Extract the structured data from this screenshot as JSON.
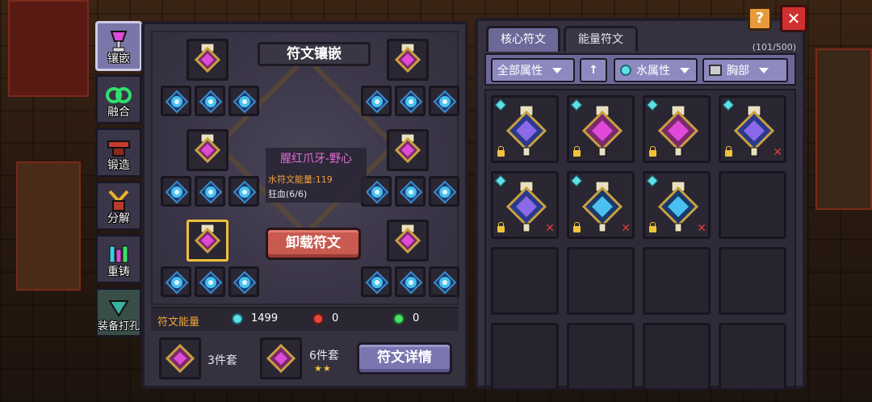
{
  "side_tabs": [
    {
      "label": "镶嵌",
      "icon": "goblet-icon",
      "active": true
    },
    {
      "label": "融合",
      "icon": "fuse-icon",
      "active": false
    },
    {
      "label": "锻造",
      "icon": "anvil-icon",
      "active": false
    },
    {
      "label": "分解",
      "icon": "decompose-icon",
      "active": false
    },
    {
      "label": "重铸",
      "icon": "recast-icon",
      "active": false
    },
    {
      "label": "装备打孔",
      "icon": "punch-icon",
      "active": false
    }
  ],
  "inlay": {
    "title": "符文镶嵌",
    "selected_rune": {
      "name": "腥红爪牙-野心",
      "energy": "水符文能量:119",
      "buff": "狂血(6/6)"
    },
    "unload_label": "卸载符文"
  },
  "energy": {
    "label": "符文能量",
    "water": "1499",
    "fire": "0",
    "nature": "0"
  },
  "sets": [
    {
      "label": "3件套"
    },
    {
      "label": "6件套",
      "stars": "★★"
    }
  ],
  "detail_label": "符文详情",
  "inventory": {
    "tabs": [
      "核心符文",
      "能量符文"
    ],
    "active_tab": 0,
    "count": "(101/500)",
    "filters": {
      "all": "全部属性",
      "sort": "↑",
      "element": "水属性",
      "slot": "胸部"
    },
    "items": [
      {
        "type": "blue-purple",
        "locked": true,
        "removable": false
      },
      {
        "type": "purple",
        "locked": true,
        "removable": false
      },
      {
        "type": "purple",
        "locked": true,
        "removable": false
      },
      {
        "type": "blue-purple",
        "locked": true,
        "removable": true
      },
      {
        "type": "blue-purple",
        "locked": true,
        "removable": true
      },
      {
        "type": "blue",
        "locked": true,
        "removable": true
      },
      {
        "type": "blue",
        "locked": true,
        "removable": true
      }
    ]
  },
  "buttons": {
    "help": "?",
    "close": "✕"
  },
  "colors": {
    "accent": "#6c6898",
    "danger": "#c85a50",
    "energy": "#f2a23a",
    "rune_name": "#e36bd8"
  }
}
